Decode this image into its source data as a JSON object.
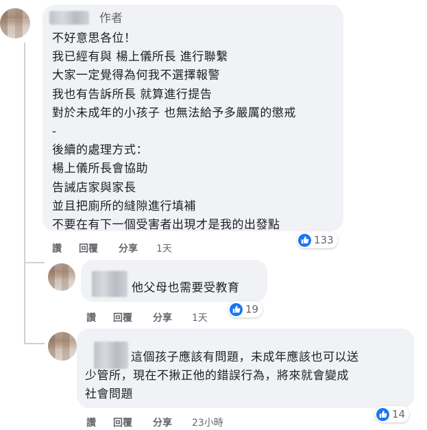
{
  "comments": [
    {
      "badge": "作者",
      "lines": [
        "不好意思各位！",
        "我已經有與 楊上儀所長 進行聯繫",
        "大家一定覺得為何我不選擇報警",
        "我也有告訴所長 就算進行提告",
        "對於未成年的小孩子 也無法給予多嚴厲的懲戒",
        "-",
        "後續的處理方式：",
        "楊上儀所長會協助",
        "告誡店家與家長",
        "並且把廁所的縫隙進行填補",
        "不要在有下一個受害者出現才是我的出發點"
      ],
      "actions": {
        "like": "讚",
        "reply": "回覆",
        "share": "分享",
        "time": "1天"
      },
      "reaction_count": "133"
    },
    {
      "lines": [
        "他父母也需要受教育"
      ],
      "actions": {
        "like": "讚",
        "reply": "回覆",
        "share": "分享",
        "time": "1天"
      },
      "reaction_count": "19"
    },
    {
      "lines": [
        "這個孩子應該有問題，未成年應該也可以送",
        "少管所，現在不揪正他的錯誤行為，將來就會變成",
        "社會問題"
      ],
      "actions": {
        "like": "讚",
        "reply": "回覆",
        "share": "分享",
        "time": "23小時"
      },
      "reaction_count": "14"
    }
  ],
  "colors": {
    "bubble": "#f0f2f5",
    "like_blue": "#1877f2",
    "secondary_text": "#65676b"
  },
  "icons": {
    "reaction": "thumbs-up-icon"
  }
}
